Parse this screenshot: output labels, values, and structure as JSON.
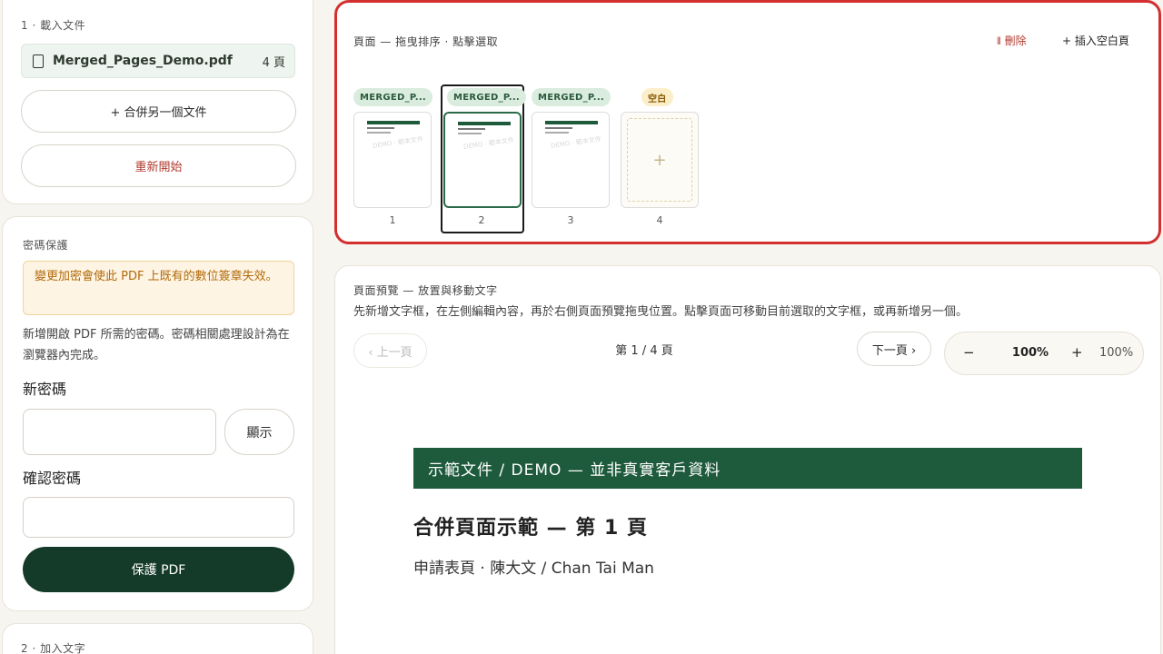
{
  "load_section": {
    "label": "1 · 載入文件",
    "file_name": "Merged_Pages_Demo.pdf",
    "file_pages": "4 頁",
    "merge_button": "+ 合併另一個文件",
    "restart_button": "重新開始"
  },
  "password_section": {
    "label": "密碼保護",
    "warning": "變更加密會使此 PDF 上既有的數位簽章失效。",
    "description": "新增開啟 PDF 所需的密碼。密碼相關處理設計為在瀏覽器內完成。",
    "new_password_label": "新密碼",
    "show_button": "顯示",
    "confirm_label": "確認密碼",
    "protect_button": "保護 PDF"
  },
  "text_section": {
    "label": "2 · 加入文字"
  },
  "pages_panel": {
    "heading": "頁面 — 拖曳排序 · 點擊選取",
    "delete_button": "刪除",
    "insert_button": "+ 插入空白頁",
    "thumbs": [
      {
        "tag": "MERGED_P...",
        "num": "1",
        "blank": false,
        "selected": false,
        "watermark": "DEMO · 範本文件"
      },
      {
        "tag": "MERGED_P...",
        "num": "2",
        "blank": false,
        "selected": true,
        "watermark": "DEMO · 範本文件"
      },
      {
        "tag": "MERGED_P...",
        "num": "3",
        "blank": false,
        "selected": false,
        "watermark": "DEMO · 範本文件"
      },
      {
        "tag": "空白",
        "num": "4",
        "blank": true,
        "selected": false,
        "plus": "+"
      }
    ]
  },
  "preview_panel": {
    "title": "頁面預覽 — 放置與移動文字",
    "help": "先新增文字框，在左側編輯內容，再於右側頁面預覽拖曳位置。點擊頁面可移動目前選取的文字框，或再新增另一個。",
    "prev_button": "‹ 上一頁",
    "page_indicator": "第 1 / 4 頁",
    "next_button": "下一頁 ›",
    "zoom_minus": "−",
    "zoom_value": "100%",
    "zoom_plus": "+",
    "zoom_readout": "100%",
    "doc_banner": "示範文件 / DEMO — 並非真實客戶資料",
    "doc_title": "合併頁面示範 — 第 1 頁",
    "doc_subtitle": "申請表頁 · 陳大文 / Chan Tai Man"
  },
  "colors": {
    "accent": "#143a2a",
    "highlight_border": "#d32f2f",
    "banner": "#1e5a3c",
    "warning_text": "#b26a0a"
  }
}
